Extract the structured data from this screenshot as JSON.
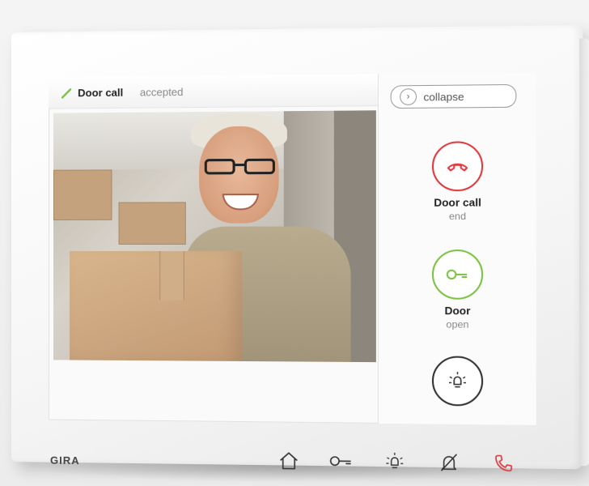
{
  "status": {
    "title": "Door call",
    "state": "accepted"
  },
  "panel": {
    "collapse_label": "collapse",
    "actions": [
      {
        "label": "Door call",
        "sub": "end",
        "icon": "phone-hangup-icon",
        "color": "#e03a3e"
      },
      {
        "label": "Door",
        "sub": "open",
        "icon": "key-icon",
        "color": "#7cc243"
      },
      {
        "label": "",
        "sub": "",
        "icon": "light-icon",
        "color": "#333333"
      }
    ]
  },
  "brand": "GIRA",
  "nav": [
    {
      "icon": "home-icon"
    },
    {
      "icon": "key-icon"
    },
    {
      "icon": "light-icon"
    },
    {
      "icon": "bell-muted-icon"
    },
    {
      "icon": "phone-icon",
      "color": "#e03a3e"
    }
  ],
  "colors": {
    "accent_red": "#e03a3e",
    "accent_green": "#7cc243"
  }
}
